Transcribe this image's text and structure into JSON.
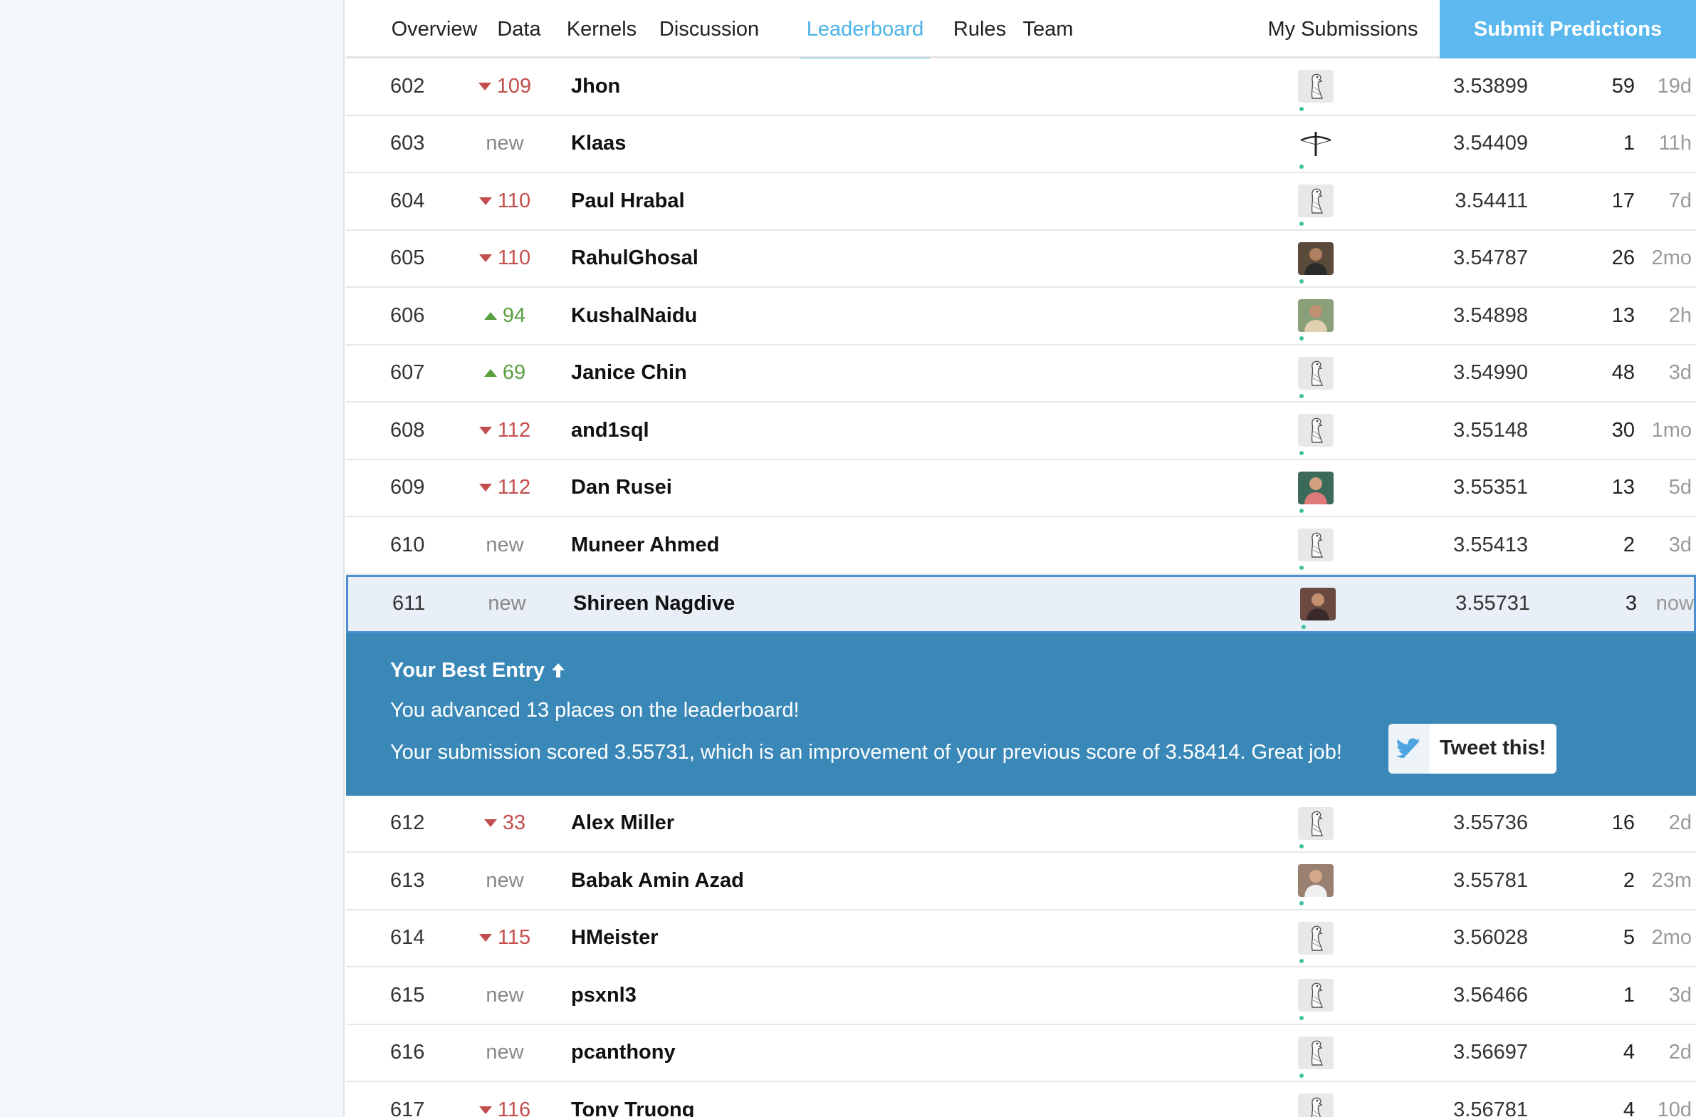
{
  "nav": {
    "tabs": [
      {
        "label": "Overview",
        "active": false
      },
      {
        "label": "Data",
        "active": false
      },
      {
        "label": "Kernels",
        "active": false
      },
      {
        "label": "Discussion",
        "active": false
      },
      {
        "label": "Leaderboard",
        "active": true
      },
      {
        "label": "Rules",
        "active": false
      },
      {
        "label": "Team",
        "active": false
      }
    ],
    "my_submissions": "My Submissions",
    "submit_label": "Submit Predictions"
  },
  "colors": {
    "accent": "#4cb3e6",
    "submit_bg": "#5cb9ef",
    "panel_bg": "#3a88b8",
    "up": "#5aa041",
    "down": "#c44e4e",
    "self_row_bg": "#e9eff6",
    "self_row_border": "#4c8fd0"
  },
  "rows_before": [
    {
      "rank": "602",
      "change_dir": "down",
      "change": "109",
      "name": "Jhon",
      "avatar": "goose-icon",
      "score": "3.53899",
      "entries": "59",
      "last": "19d"
    },
    {
      "rank": "603",
      "change_dir": "new",
      "change": "new",
      "name": "Klaas",
      "avatar": "crossbow-icon",
      "score": "3.54409",
      "entries": "1",
      "last": "11h"
    },
    {
      "rank": "604",
      "change_dir": "down",
      "change": "110",
      "name": "Paul Hrabal",
      "avatar": "goose-icon",
      "score": "3.54411",
      "entries": "17",
      "last": "7d"
    },
    {
      "rank": "605",
      "change_dir": "down",
      "change": "110",
      "name": "RahulGhosal",
      "avatar": "photo",
      "score": "3.54787",
      "entries": "26",
      "last": "2mo"
    },
    {
      "rank": "606",
      "change_dir": "up",
      "change": "94",
      "name": "KushalNaidu",
      "avatar": "photo2",
      "score": "3.54898",
      "entries": "13",
      "last": "2h"
    },
    {
      "rank": "607",
      "change_dir": "up",
      "change": "69",
      "name": "Janice Chin",
      "avatar": "goose-icon",
      "score": "3.54990",
      "entries": "48",
      "last": "3d"
    },
    {
      "rank": "608",
      "change_dir": "down",
      "change": "112",
      "name": "and1sql",
      "avatar": "goose-icon",
      "score": "3.55148",
      "entries": "30",
      "last": "1mo"
    },
    {
      "rank": "609",
      "change_dir": "down",
      "change": "112",
      "name": "Dan Rusei",
      "avatar": "photo3",
      "score": "3.55351",
      "entries": "13",
      "last": "5d"
    },
    {
      "rank": "610",
      "change_dir": "new",
      "change": "new",
      "name": "Muneer Ahmed",
      "avatar": "goose-icon",
      "score": "3.55413",
      "entries": "2",
      "last": "3d"
    }
  ],
  "self_row": {
    "rank": "611",
    "change_dir": "new",
    "change": "new",
    "name": "Shireen Nagdive",
    "avatar": "photo4",
    "score": "3.55731",
    "entries": "3",
    "last": "now"
  },
  "best_entry": {
    "title": "Your Best Entry",
    "line1": "You advanced 13 places on the leaderboard!",
    "line2": "Your submission scored 3.55731, which is an improvement of your previous score of 3.58414. Great job!",
    "tweet_label": "Tweet this!"
  },
  "rows_after": [
    {
      "rank": "612",
      "change_dir": "down",
      "change": "33",
      "name": "Alex Miller",
      "avatar": "goose-icon",
      "score": "3.55736",
      "entries": "16",
      "last": "2d"
    },
    {
      "rank": "613",
      "change_dir": "new",
      "change": "new",
      "name": "Babak Amin Azad",
      "avatar": "photo5",
      "score": "3.55781",
      "entries": "2",
      "last": "23m"
    },
    {
      "rank": "614",
      "change_dir": "down",
      "change": "115",
      "name": "HMeister",
      "avatar": "goose-icon",
      "score": "3.56028",
      "entries": "5",
      "last": "2mo"
    },
    {
      "rank": "615",
      "change_dir": "new",
      "change": "new",
      "name": "psxnl3",
      "avatar": "goose-icon",
      "score": "3.56466",
      "entries": "1",
      "last": "3d"
    },
    {
      "rank": "616",
      "change_dir": "new",
      "change": "new",
      "name": "pcanthony",
      "avatar": "goose-icon",
      "score": "3.56697",
      "entries": "4",
      "last": "2d"
    },
    {
      "rank": "617",
      "change_dir": "down",
      "change": "116",
      "name": "Tony Truong",
      "avatar": "goose-icon",
      "score": "3.56781",
      "entries": "4",
      "last": "10d"
    }
  ]
}
